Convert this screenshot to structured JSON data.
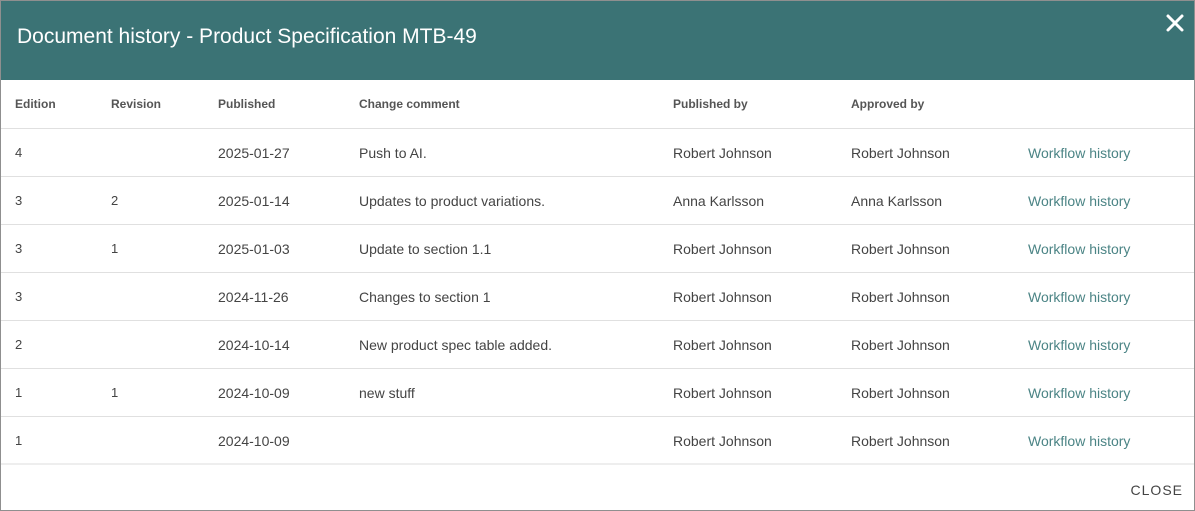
{
  "dialog": {
    "title": "Document history - Product Specification MTB-49",
    "close_button_label": "CLOSE",
    "close_icon": "close-x-icon",
    "colors": {
      "header_background": "#3b7375",
      "link": "#4b8485"
    }
  },
  "table": {
    "columns": {
      "edition": "Edition",
      "revision": "Revision",
      "published": "Published",
      "change_comment": "Change comment",
      "published_by": "Published by",
      "approved_by": "Approved by"
    },
    "rows": [
      {
        "edition": "4",
        "revision": "",
        "published": "2025-01-27",
        "change_comment": "Push to AI.",
        "published_by": "Robert Johnson",
        "approved_by": "Robert Johnson",
        "action": "Workflow history"
      },
      {
        "edition": "3",
        "revision": "2",
        "published": "2025-01-14",
        "change_comment": "Updates to product variations.",
        "published_by": "Anna Karlsson",
        "approved_by": "Anna Karlsson",
        "action": "Workflow history"
      },
      {
        "edition": "3",
        "revision": "1",
        "published": "2025-01-03",
        "change_comment": "Update to section 1.1",
        "published_by": "Robert Johnson",
        "approved_by": "Robert Johnson",
        "action": "Workflow history"
      },
      {
        "edition": "3",
        "revision": "",
        "published": "2024-11-26",
        "change_comment": "Changes to section 1",
        "published_by": "Robert Johnson",
        "approved_by": "Robert Johnson",
        "action": "Workflow history"
      },
      {
        "edition": "2",
        "revision": "",
        "published": "2024-10-14",
        "change_comment": "New product spec table added.",
        "published_by": "Robert Johnson",
        "approved_by": "Robert Johnson",
        "action": "Workflow history"
      },
      {
        "edition": "1",
        "revision": "1",
        "published": "2024-10-09",
        "change_comment": "new stuff",
        "published_by": "Robert Johnson",
        "approved_by": "Robert Johnson",
        "action": "Workflow history"
      },
      {
        "edition": "1",
        "revision": "",
        "published": "2024-10-09",
        "change_comment": "",
        "published_by": "Robert Johnson",
        "approved_by": "Robert Johnson",
        "action": "Workflow history"
      }
    ]
  }
}
